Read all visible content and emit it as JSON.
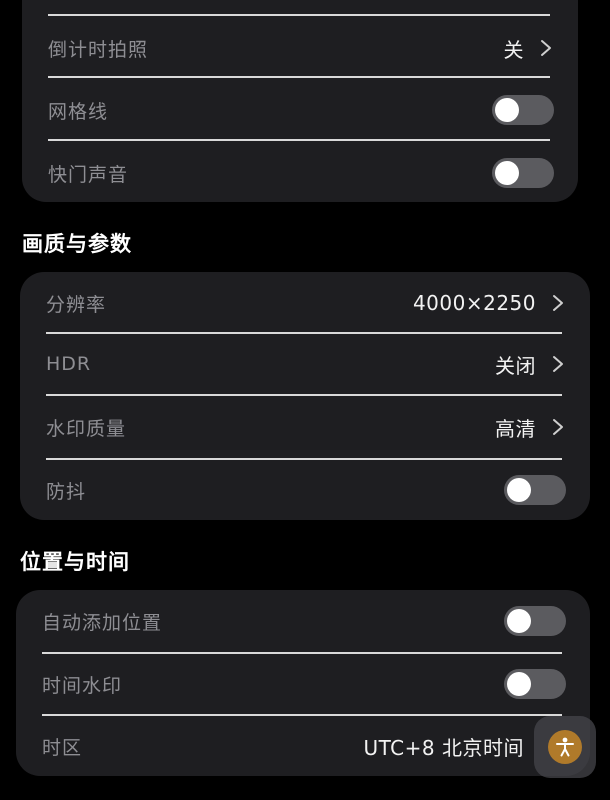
{
  "top_card": {
    "rows": [
      {
        "label": "倒计时拍照",
        "value": "关"
      },
      {
        "label": "网格线",
        "toggle": "off"
      },
      {
        "label": "快门声音",
        "toggle": "off"
      }
    ]
  },
  "quality_section": {
    "title": "画质与参数",
    "rows": [
      {
        "label": "分辨率",
        "value": "4000×2250"
      },
      {
        "label": "HDR",
        "value": "关闭"
      },
      {
        "label": "水印质量",
        "value": "高清"
      },
      {
        "label": "防抖",
        "toggle": "off"
      }
    ]
  },
  "location_section": {
    "title": "位置与时间",
    "rows": [
      {
        "label": "自动添加位置",
        "toggle": "off"
      },
      {
        "label": "时间水印",
        "toggle": "off"
      },
      {
        "label": "时区",
        "value": "UTC+8 北京时间"
      }
    ]
  },
  "icons": {
    "chevron": "chevron-right-icon",
    "accessibility": "accessibility-icon"
  },
  "colors": {
    "background": "#000000",
    "card": "#1e1e21",
    "toggle_off": "#5b5b5f",
    "accent": "#b07a2a"
  }
}
